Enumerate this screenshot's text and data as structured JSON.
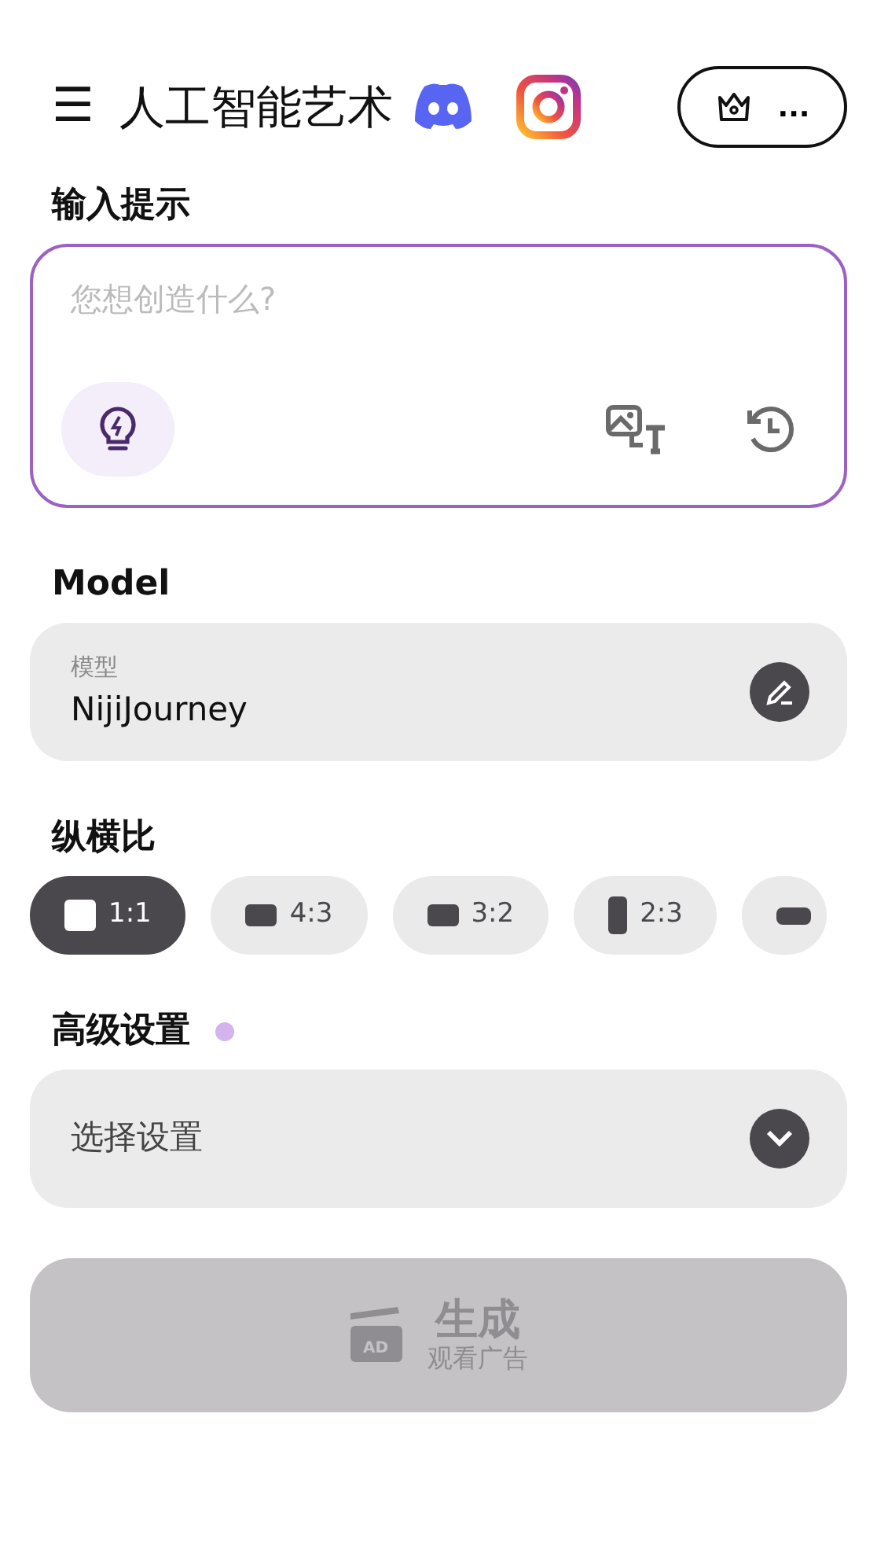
{
  "header": {
    "menu_icon": "☰",
    "title": "人工智能艺术",
    "premium_label": "..."
  },
  "prompt": {
    "label": "输入提示",
    "placeholder": "您想创造什么?"
  },
  "model": {
    "label": "Model",
    "field_label": "模型",
    "value": "NijiJourney"
  },
  "aspect": {
    "label": "纵横比",
    "options": [
      {
        "label": "1:1",
        "kind": "square",
        "selected": true
      },
      {
        "label": "4:3",
        "kind": "landscape",
        "selected": false
      },
      {
        "label": "3:2",
        "kind": "landscape",
        "selected": false
      },
      {
        "label": "2:3",
        "kind": "portrait",
        "selected": false
      },
      {
        "kind": "wide",
        "selected": false
      }
    ]
  },
  "advanced": {
    "label": "高级设置",
    "new_indicator": true,
    "value": "选择设置"
  },
  "generate": {
    "label": "生成",
    "sublabel": "观看广告",
    "ad_label": "AD",
    "disabled": true
  }
}
